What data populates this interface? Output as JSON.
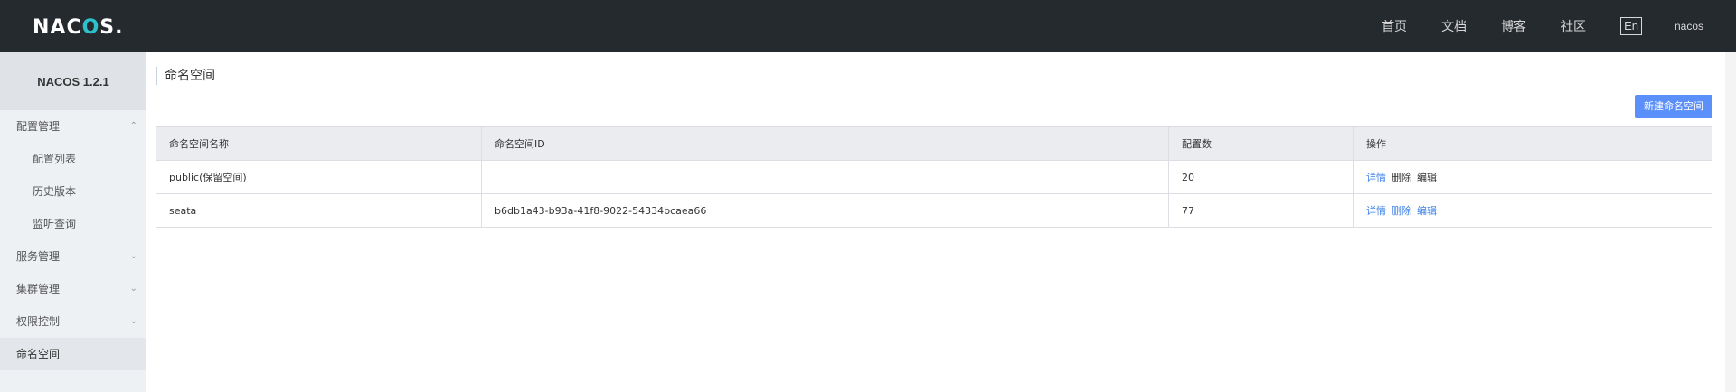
{
  "header": {
    "logo_text_1": "NAC",
    "logo_text_2": "O",
    "logo_text_3": "S.",
    "nav": [
      "首页",
      "文档",
      "博客",
      "社区"
    ],
    "lang": "En",
    "user": "nacos"
  },
  "sidebar": {
    "version": "NACOS 1.2.1",
    "items": [
      {
        "label": "配置管理",
        "chevron": "up"
      },
      {
        "label": "配置列表"
      },
      {
        "label": "历史版本"
      },
      {
        "label": "监听查询"
      },
      {
        "label": "服务管理",
        "chevron": "down"
      },
      {
        "label": "集群管理",
        "chevron": "down"
      },
      {
        "label": "权限控制",
        "chevron": "down"
      },
      {
        "label": "命名空间"
      }
    ]
  },
  "main": {
    "title": "命名空间",
    "new_button": "新建命名空间",
    "columns": [
      "命名空间名称",
      "命名空间ID",
      "配置数",
      "操作"
    ],
    "rows": [
      {
        "name": "public(保留空间)",
        "id": "",
        "count": "20",
        "ops": [
          "详情",
          "删除",
          "编辑"
        ]
      },
      {
        "name": "seata",
        "id": "b6db1a43-b93a-41f8-9022-54334bcaea66",
        "count": "77",
        "ops": [
          "详情",
          "删除",
          "编辑"
        ]
      }
    ]
  },
  "colors": {
    "topbar": "#252a2f",
    "accent": "#5b8ff9",
    "link": "#3f82e6",
    "logo_o": "#2ec1cc"
  },
  "icons": {
    "chevron_up": "chevron-up-icon",
    "chevron_down": "chevron-down-icon"
  }
}
